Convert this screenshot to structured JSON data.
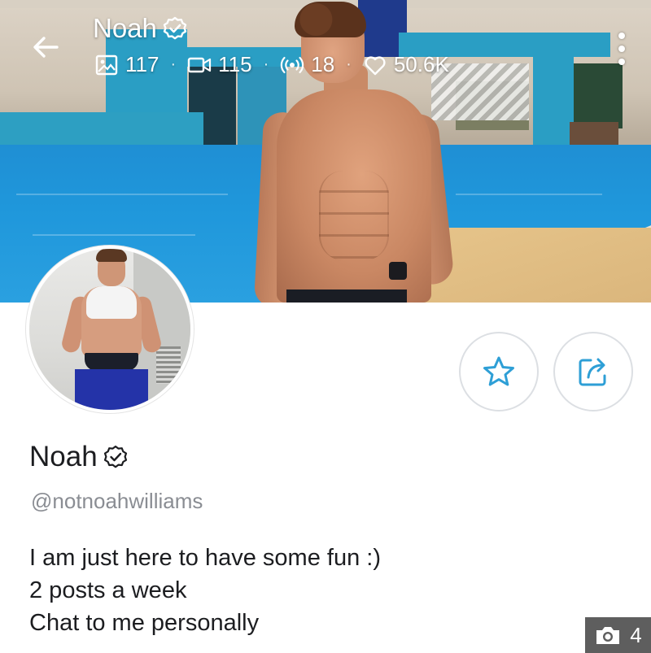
{
  "header": {
    "title": "Noah",
    "back_icon": "arrow-left-icon",
    "verified_icon": "verified-badge-icon",
    "more_icon": "more-vertical-icon",
    "stats": [
      {
        "icon": "image-icon",
        "value": "117"
      },
      {
        "icon": "video-icon",
        "value": "115"
      },
      {
        "icon": "broadcast-icon",
        "value": "18"
      },
      {
        "icon": "heart-icon",
        "value": "50.6K"
      }
    ],
    "separator": "·"
  },
  "actions": {
    "favorite_icon": "star-icon",
    "share_icon": "share-icon",
    "accent_color": "#2e9fd6"
  },
  "profile": {
    "name": "Noah",
    "handle": "@notnoahwilliams",
    "bio": [
      "I am just here to have some fun :)",
      "2 posts a week",
      "Chat to me personally"
    ]
  },
  "photo_counter": {
    "icon": "camera-icon",
    "count": "4"
  }
}
